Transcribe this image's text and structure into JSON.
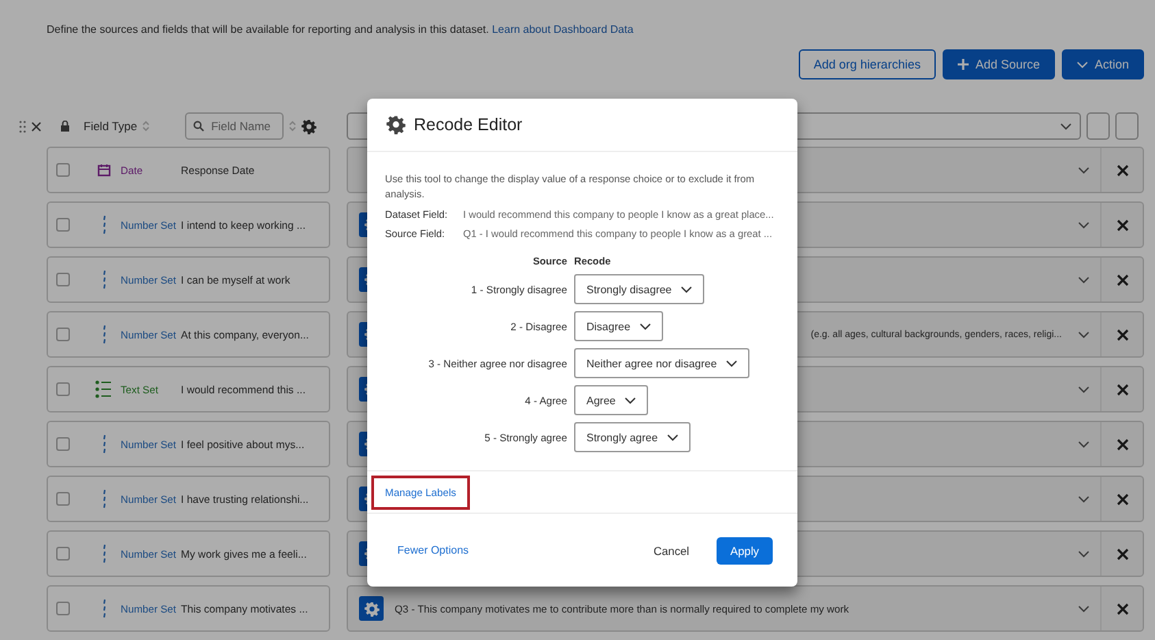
{
  "intro": {
    "text": "Define the sources and fields that will be available for reporting and analysis in this dataset.",
    "link": "Learn about Dashboard Data"
  },
  "toolbar": {
    "buttons": [
      {
        "label": "Add org hierarchies",
        "kind": "outline"
      },
      {
        "label": "Add Source",
        "kind": "add"
      },
      {
        "label": "Action",
        "kind": "menu"
      }
    ]
  },
  "header": {
    "field_type": "Field Type",
    "search": {
      "placeholder": "Field Name"
    }
  },
  "rows": [
    {
      "checked": false,
      "type": "Date",
      "kind": "date",
      "name": "Response Date",
      "mapping": {
        "icon": false
      }
    },
    {
      "checked": false,
      "type": "Number Set",
      "kind": "number",
      "name": "I intend to keep working ...",
      "mapping": {
        "icon": true
      }
    },
    {
      "checked": false,
      "type": "Number Set",
      "kind": "number",
      "name": "I can be myself at work",
      "mapping": {
        "icon": true
      }
    },
    {
      "checked": false,
      "type": "Number Set",
      "kind": "number",
      "name": "At this company, everyon...",
      "mapping": {
        "icon": true,
        "kind": "tail",
        "text": "(e.g. all ages, cultural backgrounds, genders, races, religi..."
      }
    },
    {
      "checked": false,
      "type": "Text Set",
      "kind": "text",
      "name": "I would recommend this ...",
      "mapping": {
        "icon": true
      }
    },
    {
      "checked": false,
      "type": "Number Set",
      "kind": "number",
      "name": "I feel positive about mys...",
      "mapping": {
        "icon": true
      }
    },
    {
      "checked": false,
      "type": "Number Set",
      "kind": "number",
      "name": "I have trusting relationshi...",
      "mapping": {
        "icon": true
      }
    },
    {
      "checked": false,
      "type": "Number Set",
      "kind": "number",
      "name": "My work gives me a feeli...",
      "mapping": {
        "icon": true
      }
    },
    {
      "checked": false,
      "type": "Number Set",
      "kind": "number",
      "name": "This company motivates ...",
      "mapping": {
        "icon": true,
        "kind": "full",
        "text": "Q3 - This company motivates me to contribute more than is normally required to complete my work"
      }
    }
  ],
  "dialog": {
    "title": "Recode Editor",
    "description": "Use this tool to change the display value of a response choice or to exclude it from analysis.",
    "fields": [
      {
        "label": "Dataset Field:",
        "value": "I would recommend this company to people I know as a great place..."
      },
      {
        "label": "Source Field:",
        "value": "Q1 - I would recommend this company to people I know as a great ..."
      }
    ],
    "columns": [
      "Source",
      "Recode"
    ],
    "recodes": [
      {
        "source": "1 - Strongly disagree",
        "recode": "Strongly disagree"
      },
      {
        "source": "2 - Disagree",
        "recode": "Disagree"
      },
      {
        "source": "3 - Neither agree nor disagree",
        "recode": "Neither agree nor disagree"
      },
      {
        "source": "4 - Agree",
        "recode": "Agree"
      },
      {
        "source": "5 - Strongly agree",
        "recode": "Strongly agree"
      }
    ],
    "manage_link": {
      "label": "Manage Labels",
      "highlighted": true
    },
    "fewer": "Fewer Options",
    "cancel": "Cancel",
    "apply": "Apply"
  }
}
